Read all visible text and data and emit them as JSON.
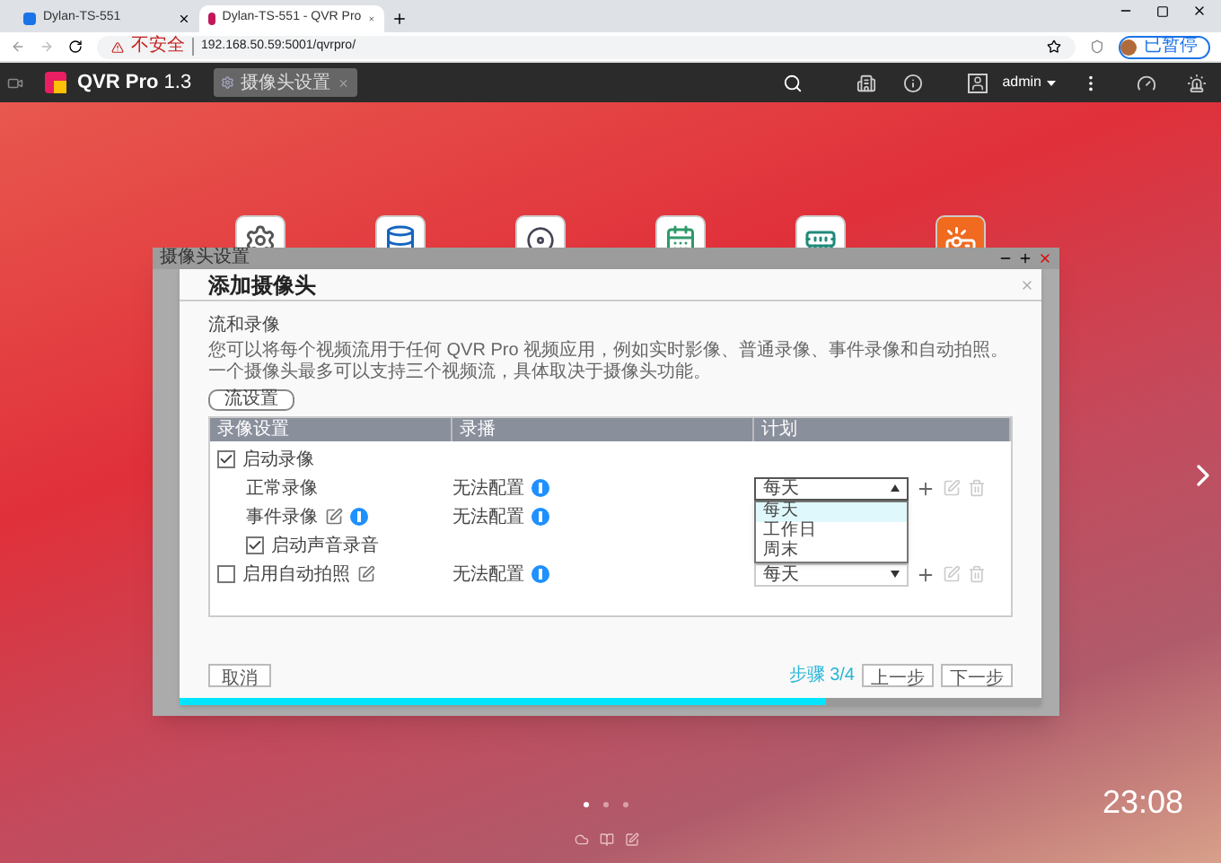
{
  "browser": {
    "tabs": [
      {
        "title": "Dylan-TS-551",
        "selected": false
      },
      {
        "title": "Dylan-TS-551 - QVR Pro",
        "selected": true
      }
    ],
    "security": "不安全",
    "url": "192.168.50.59:5001/qvrpro/",
    "profile_status": "已暂停"
  },
  "app_bar": {
    "product": "QVR Pro",
    "version": "1.3",
    "tabs": [
      {
        "label": "摄像头设置"
      }
    ],
    "user": "admin"
  },
  "desktop": {
    "pages": [
      {
        "selected": true
      },
      {
        "selected": false
      },
      {
        "selected": false
      }
    ],
    "clock": "23:08"
  },
  "window": {
    "title": "摄像头设置",
    "dialog": {
      "title": "添加摄像头",
      "section": "流和录像",
      "description": "您可以将每个视频流用于任何 QVR Pro 视频应用，例如实时影像、普通录像、事件录像和自动拍照。一个摄像头最多可以支持三个视频流，具体取决于摄像头功能。",
      "stream_button": "流设置",
      "table": {
        "columns": [
          "录像设置",
          "录播",
          "计划"
        ],
        "rows": [
          {
            "kind": "group",
            "label": "启动录像",
            "checked": true
          },
          {
            "kind": "sub",
            "label": "正常录像",
            "status": "无法配置",
            "schedule": "每天",
            "open": true,
            "options": [
              {
                "label": "每天",
                "selected": true
              },
              {
                "label": "工作日",
                "selected": false
              },
              {
                "label": "周末",
                "selected": false
              }
            ]
          },
          {
            "kind": "sub",
            "label": "事件录像",
            "editable": true,
            "info": true,
            "status": "无法配置"
          },
          {
            "kind": "sub",
            "label": "启动声音录音",
            "checked": true
          },
          {
            "kind": "group",
            "label": "启用自动拍照",
            "checked": false,
            "editable": true,
            "status": "无法配置",
            "schedule": "每天",
            "open": false
          }
        ]
      },
      "cancel": "取消",
      "step": "步骤 3/4",
      "back": "上一步",
      "next": "下一步",
      "progress": {
        "level": 0.75
      }
    }
  }
}
